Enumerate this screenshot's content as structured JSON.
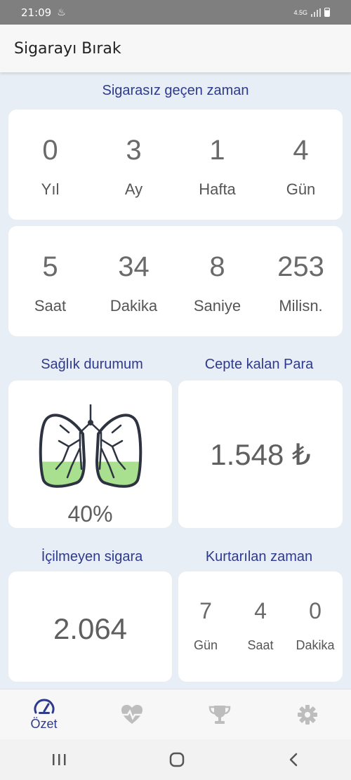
{
  "status_bar": {
    "time": "21:09",
    "network": "4.5G"
  },
  "app": {
    "title": "Sigarayı Bırak"
  },
  "elapsed": {
    "title": "Sigarasız geçen zaman",
    "row1": [
      {
        "value": "0",
        "label": "Yıl"
      },
      {
        "value": "3",
        "label": "Ay"
      },
      {
        "value": "1",
        "label": "Hafta"
      },
      {
        "value": "4",
        "label": "Gün"
      }
    ],
    "row2": [
      {
        "value": "5",
        "label": "Saat"
      },
      {
        "value": "34",
        "label": "Dakika"
      },
      {
        "value": "8",
        "label": "Saniye"
      },
      {
        "value": "253",
        "label": "Milisn."
      }
    ]
  },
  "health": {
    "title": "Sağlık durumum",
    "percent": "40%",
    "fill_fraction": 0.4,
    "fill_color": "#a8e08f"
  },
  "money": {
    "title": "Cepte kalan Para",
    "value": "1.548 ₺"
  },
  "cigarettes": {
    "title": "İçilmeyen sigara",
    "value": "2.064"
  },
  "saved_time": {
    "title": "Kurtarılan zaman",
    "items": [
      {
        "value": "7",
        "label": "Gün"
      },
      {
        "value": "4",
        "label": "Saat"
      },
      {
        "value": "0",
        "label": "Dakika"
      }
    ]
  },
  "bottom_nav": {
    "summary_label": "Özet",
    "active_color": "#2e3a8c",
    "inactive_color": "#bdbdbd",
    "icons": [
      "speedometer-icon",
      "heart-pulse-icon",
      "trophy-icon",
      "gear-icon"
    ]
  }
}
